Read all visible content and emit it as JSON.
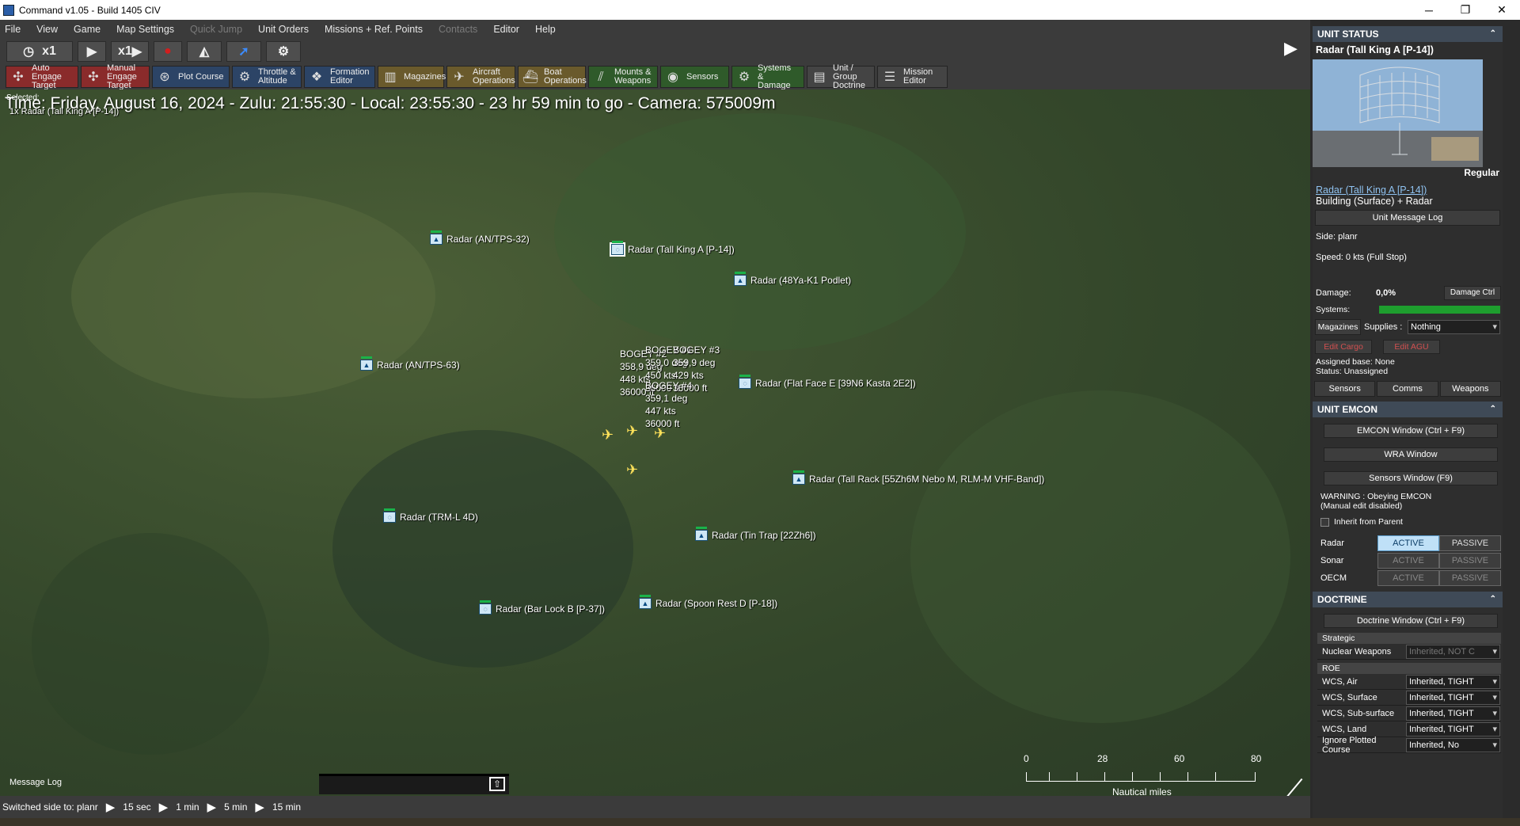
{
  "window": {
    "title": "Command v1.05 - Build 1405 CIV",
    "minimize": "─",
    "maximize": "❐",
    "close": "✕"
  },
  "menu": {
    "items": [
      "File",
      "View",
      "Game",
      "Map Settings",
      "Quick Jump",
      "Unit Orders",
      "Missions + Ref. Points",
      "Contacts",
      "Editor",
      "Help"
    ],
    "disabled": [
      "Quick Jump",
      "Contacts"
    ]
  },
  "toolbar1": {
    "clock_speed": "x1",
    "time_compression": "x1"
  },
  "toolbar2": {
    "buttons": [
      {
        "label": "Auto Engage\nTarget",
        "icon": "auto-engage-icon",
        "glyph": "✣",
        "color": "#8a2b2b"
      },
      {
        "label": "Manual\nEngage Target",
        "icon": "manual-engage-icon",
        "glyph": "✣",
        "color": "#8a2b2b"
      },
      {
        "label": "Plot Course",
        "icon": "plot-course-icon",
        "glyph": "⊛",
        "color": "#2c4466"
      },
      {
        "label": "Throttle &\nAltitude",
        "icon": "throttle-icon",
        "glyph": "⚙",
        "color": "#2c4466"
      },
      {
        "label": "Formation\nEditor",
        "icon": "formation-icon",
        "glyph": "❖",
        "color": "#2c4466"
      },
      {
        "label": "Magazines",
        "icon": "magazines-icon",
        "glyph": "▥",
        "color": "#6a5a2c"
      },
      {
        "label": "Aircraft\nOperations",
        "icon": "aircraft-icon",
        "glyph": "✈",
        "color": "#6a5a2c"
      },
      {
        "label": "Boat\nOperations",
        "icon": "boat-icon",
        "glyph": "⛴",
        "color": "#6a5a2c"
      },
      {
        "label": "Mounts &\nWeapons",
        "icon": "mounts-icon",
        "glyph": "⫽",
        "color": "#2f5a2a"
      },
      {
        "label": "Sensors",
        "icon": "sensors-icon",
        "glyph": "◉",
        "color": "#2f5a2a"
      },
      {
        "label": "Systems &\nDamage",
        "icon": "systems-icon",
        "glyph": "⚙",
        "color": "#2f5a2a"
      },
      {
        "label": "Unit / Group\nDoctrine",
        "icon": "doctrine-icon",
        "glyph": "▤",
        "color": "#444444"
      },
      {
        "label": "Mission\nEditor",
        "icon": "mission-editor-icon",
        "glyph": "☰",
        "color": "#444444"
      }
    ]
  },
  "map": {
    "time_line": "Time: Friday, August 16, 2024 - Zulu: 21:55:30 - Local: 23:55:30 - 23 hr 59 min to go -  Camera: 575009m",
    "selected_label": "Selected:",
    "selected_unit": "1x Radar (Tall King A [P-14])",
    "units": [
      {
        "name": "Radar (AN/TPS-32)",
        "glyph": "▲"
      },
      {
        "name": "Radar (Tall King A [P-14])",
        "glyph": "◌"
      },
      {
        "name": "Radar (48Ya-K1 Podlet)",
        "glyph": "▲"
      },
      {
        "name": "Radar (AN/TPS-63)",
        "glyph": "▲"
      },
      {
        "name": "Radar (Flat Face E [39N6 Kasta 2E2])",
        "glyph": "◌"
      },
      {
        "name": "Radar (Tall Rack [55Zh6M Nebo M, RLM-M VHF-Band])",
        "glyph": "▲"
      },
      {
        "name": "Radar (TRM-L 4D)",
        "glyph": "◌"
      },
      {
        "name": "Radar (Tin Trap [22Zh6])",
        "glyph": "▲"
      },
      {
        "name": "Radar (Bar Lock B [P-37])",
        "glyph": "◌"
      },
      {
        "name": "Radar (Spoon Rest D [P-18])",
        "glyph": "▲"
      }
    ],
    "contacts": [
      {
        "name": "BOGEY #2",
        "heading": "358,9 deg",
        "speed": "448 kts",
        "alt": "36000 ft"
      },
      {
        "name": "BOGEY #1",
        "heading": "359,0 deg",
        "speed": "450 kts",
        "alt": "36000 ft"
      },
      {
        "name": "BOGEY #3",
        "heading": "359,9 deg",
        "speed": "429 kts",
        "alt": "36000 ft"
      },
      {
        "name": "BOGEY #4",
        "heading": "359,1 deg",
        "speed": "447 kts",
        "alt": "36000 ft"
      }
    ],
    "scale": {
      "ticks": [
        "0",
        "28",
        "60",
        "80"
      ],
      "unit": "Nautical miles"
    }
  },
  "message_log": {
    "label": "Message Log"
  },
  "statusbar": {
    "text": "Switched side to: planr",
    "steps": [
      "15 sec",
      "1 min",
      "5 min",
      "15 min"
    ]
  },
  "panel": {
    "unit_status": {
      "header": "UNIT STATUS",
      "unit_name": "Radar (Tall King A [P-14])",
      "proficiency": "Regular",
      "unit_link": "Radar (Tall King A [P-14])",
      "unit_type": "Building (Surface) + Radar",
      "msg_log_btn": "Unit Message Log",
      "side": "Side: planr",
      "speed": "Speed: 0 kts (Full Stop)",
      "damage_label": "Damage:",
      "damage_value": "0,0%",
      "damage_btn": "Damage Ctrl",
      "systems_label": "Systems:",
      "systems_health": 1.0,
      "magazines_btn": "Magazines",
      "supplies_label": "Supplies :",
      "supplies_value": "Nothing",
      "edit_cargo": "Edit Cargo",
      "edit_agu": "Edit AGU",
      "assigned_base": "Assigned base: None",
      "status": "Status: Unassigned",
      "tabs": [
        "Sensors",
        "Comms",
        "Weapons"
      ]
    },
    "emcon": {
      "header": "UNIT EMCON",
      "emcon_btn": "EMCON Window (Ctrl + F9)",
      "wra_btn": "WRA Window",
      "sensors_btn": "Sensors Window (F9)",
      "warning": "WARNING : Obeying EMCON\n(Manual edit disabled)",
      "inherit": "Inherit from Parent",
      "rows": [
        {
          "label": "Radar",
          "active": "ACTIVE",
          "passive": "PASSIVE",
          "state": "active"
        },
        {
          "label": "Sonar",
          "active": "ACTIVE",
          "passive": "PASSIVE",
          "state": "none"
        },
        {
          "label": "OECM",
          "active": "ACTIVE",
          "passive": "PASSIVE",
          "state": "none"
        }
      ]
    },
    "doctrine": {
      "header": "DOCTRINE",
      "doctrine_btn": "Doctrine Window (Ctrl + F9)",
      "strategic": "Strategic",
      "nuclear_label": "Nuclear Weapons",
      "nuclear_value": "Inherited, NOT C",
      "roe": "ROE",
      "rows": [
        {
          "label": "WCS, Air",
          "value": "Inherited, TIGHT"
        },
        {
          "label": "WCS, Surface",
          "value": "Inherited, TIGHT"
        },
        {
          "label": "WCS, Sub-surface",
          "value": "Inherited, TIGHT"
        },
        {
          "label": "WCS, Land",
          "value": "Inherited, TIGHT"
        },
        {
          "label": "Ignore Plotted Course",
          "value": "Inherited, No"
        }
      ]
    }
  },
  "colors": {
    "panel_header": "#3f4a57",
    "active_button": "#bfe0f7",
    "health_bar": "#1e9e2e",
    "contact": "#ffe25a",
    "unit_status_green": "#1ab24a"
  }
}
